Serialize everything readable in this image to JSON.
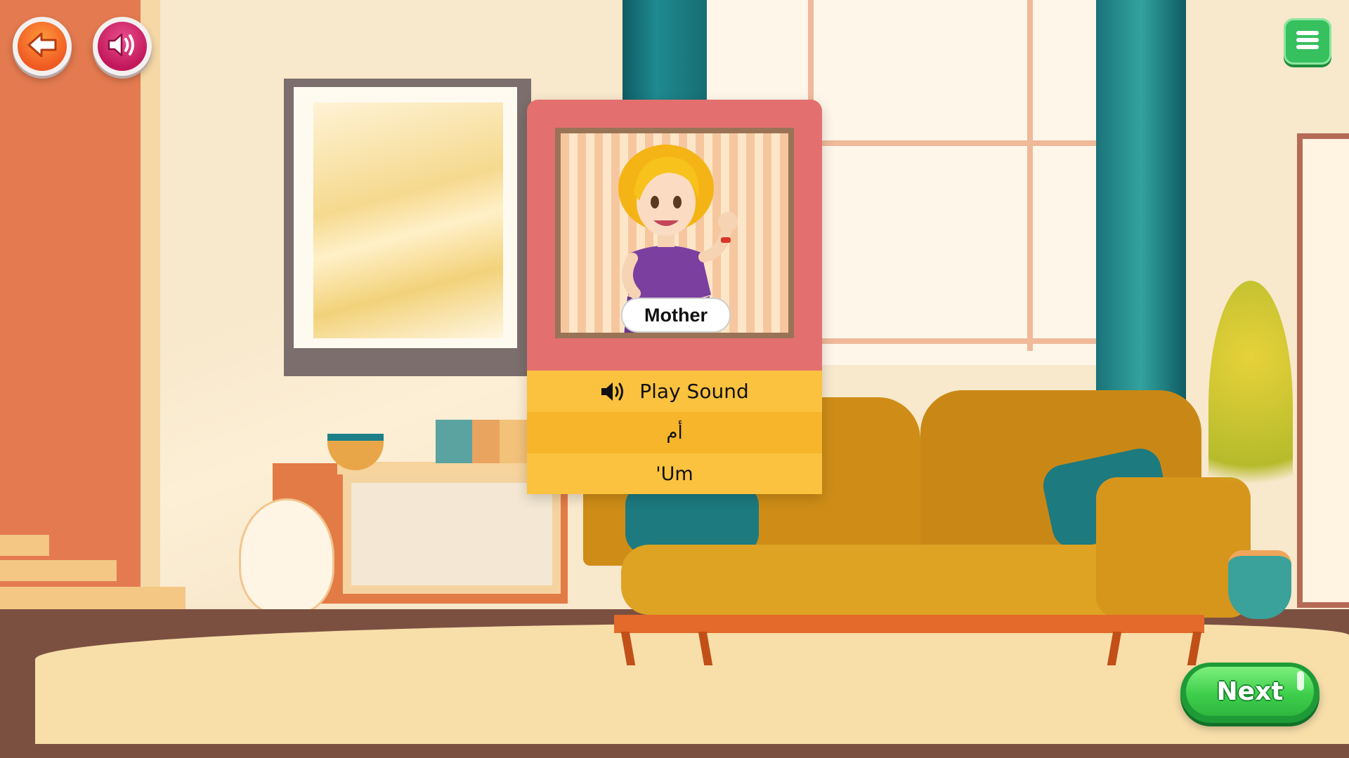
{
  "top_bar": {
    "back_icon": "arrow-left-icon",
    "sound_icon": "speaker-icon",
    "menu_icon": "hamburger-menu-icon"
  },
  "card": {
    "word": "Mother",
    "play_label": "Play Sound",
    "play_icon": "speaker-icon",
    "arabic": "أم",
    "transliteration": "'Um"
  },
  "next_label": "Next",
  "colors": {
    "card_top": "#e3706f",
    "card_rows": "#fbc23f",
    "next_green": "#3fcf4c",
    "back_orange": "#f05a22",
    "sound_magenta": "#c2185b"
  }
}
